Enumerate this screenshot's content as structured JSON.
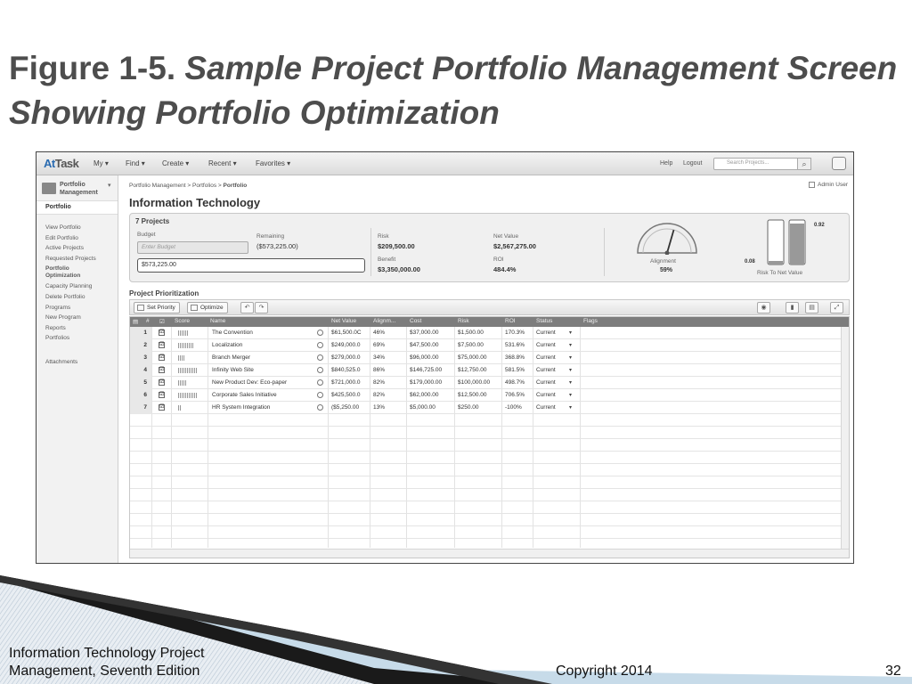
{
  "slide": {
    "title_prefix": "Figure 1-5.",
    "title_italic": "Sample Project Portfolio Management Screen Showing Portfolio Optimization",
    "footer_left_line1": "Information Technology Project",
    "footer_left_line2": "Management, Seventh Edition",
    "footer_copyright": "Copyright 2014",
    "footer_page": "32"
  },
  "app": {
    "logo_a": "At",
    "logo_b": "Task",
    "menu": [
      "My ▾",
      "Find ▾",
      "Create ▾",
      "Recent ▾",
      "Favorites ▾"
    ],
    "help": "Help",
    "logout": "Logout",
    "search_placeholder": "Search Projects...",
    "admin_user": "Admin User"
  },
  "sidebar": {
    "module": "Portfolio Management",
    "active": "Portfolio",
    "items": [
      "View Portfolio",
      "Edit Portfolio",
      "Active Projects",
      "Requested Projects",
      "Portfolio Optimization",
      "Capacity Planning",
      "Delete Portfolio",
      "Programs",
      "New Program",
      "Reports",
      "Portfolios"
    ],
    "attachments": "Attachments"
  },
  "main": {
    "breadcrumb_path": "Portfolio Management  >  Portfolios  >  ",
    "breadcrumb_current": "Portfolio",
    "title": "Information Technology",
    "summary": {
      "projects_count": "7 Projects",
      "budget_label": "Budget",
      "budget_placeholder": "Enter Budget",
      "budget_value": "$573,225.00",
      "remaining_label": "Remaining",
      "remaining_value": "($573,225.00)",
      "risk_label": "Risk",
      "risk_value": "$209,500.00",
      "benefit_label": "Benefit",
      "benefit_value": "$3,350,000.00",
      "net_value_label": "Net Value",
      "net_value_value": "$2,567,275.00",
      "roi_label": "ROI",
      "roi_value": "484.4%",
      "alignment_label": "Alignment",
      "alignment_value": "59%",
      "alignment_fraction": 0.59,
      "risk_to_net_label": "Risk To Net Value",
      "risk_bar_value": "0.08",
      "net_bar_value": "0.92",
      "risk_bar_fraction": 0.08,
      "net_bar_fraction": 0.92
    },
    "prioritization": {
      "heading": "Project Prioritization",
      "set_priority": "Set Priority",
      "optimize": "Optimize",
      "columns": [
        "#",
        "",
        "Score",
        "Name",
        "",
        "Net Value",
        "Alignm...",
        "Cost",
        "Risk",
        "ROI",
        "Status",
        "Flags"
      ],
      "rows": [
        {
          "num": "1",
          "check": "☑",
          "score": 0.45,
          "name": "The Convention",
          "net_value": "$61,500.0C",
          "alignment": "46%",
          "cost": "$37,000.00",
          "risk": "$1,500.00",
          "roi": "170.3%",
          "status": "Current"
        },
        {
          "num": "2",
          "check": "☑",
          "score": 0.7,
          "name": "Localization",
          "net_value": "$249,000.0",
          "alignment": "69%",
          "cost": "$47,500.00",
          "risk": "$7,500.00",
          "roi": "531.6%",
          "status": "Current"
        },
        {
          "num": "3",
          "check": "☑",
          "score": 0.3,
          "name": "Branch Merger",
          "net_value": "$279,000.0",
          "alignment": "34%",
          "cost": "$96,000.00",
          "risk": "$75,000.00",
          "roi": "368.8%",
          "status": "Current"
        },
        {
          "num": "4",
          "check": "☑",
          "score": 0.85,
          "name": "Infinity Web Site",
          "net_value": "$840,525.0",
          "alignment": "86%",
          "cost": "$146,725.00",
          "risk": "$12,750.00",
          "roi": "581.5%",
          "status": "Current"
        },
        {
          "num": "5",
          "check": "☑",
          "score": 0.4,
          "name": "New Product Dev: Eco-paper",
          "net_value": "$721,000.0",
          "alignment": "82%",
          "cost": "$179,000.00",
          "risk": "$100,000.00",
          "roi": "498.7%",
          "status": "Current"
        },
        {
          "num": "6",
          "check": "☑",
          "score": 0.8,
          "name": "Corporate Sales Initiative",
          "net_value": "$425,500.0",
          "alignment": "82%",
          "cost": "$62,000.00",
          "risk": "$12,500.00",
          "roi": "706.5%",
          "status": "Current"
        },
        {
          "num": "7",
          "check": "☑",
          "score": 0.1,
          "name": "HR System Integration",
          "net_value": "($5,250.00",
          "alignment": "13%",
          "cost": "$5,000.00",
          "risk": "$250.00",
          "roi": "-100%",
          "status": "Current"
        }
      ]
    }
  }
}
